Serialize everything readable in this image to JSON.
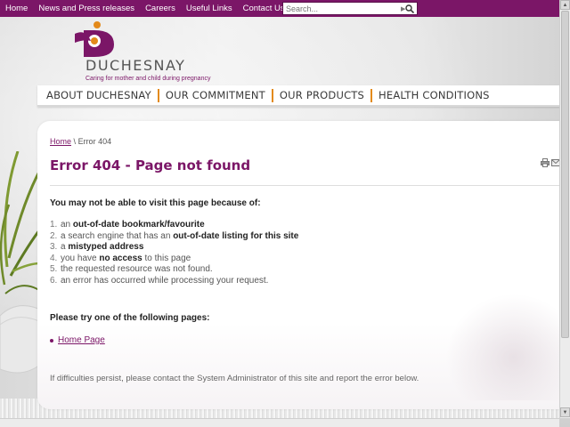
{
  "topnav": {
    "items": [
      "Home",
      "News and Press releases",
      "Careers",
      "Useful Links",
      "Contact Us"
    ]
  },
  "search": {
    "placeholder": "Search..."
  },
  "logo": {
    "name": "DUCHESNAY",
    "tagline": "Caring for mother and child during pregnancy"
  },
  "mainmenu": {
    "items": [
      "ABOUT DUCHESNAY",
      "OUR COMMITMENT",
      "OUR PRODUCTS",
      "HEALTH CONDITIONS"
    ]
  },
  "breadcrumb": {
    "home": "Home",
    "separator": "\\",
    "current": "Error 404"
  },
  "page": {
    "title": "Error 404 - Page not found",
    "intro": "You may not be able to visit this page because of:",
    "reasons": [
      {
        "num": "1.",
        "pre": "an ",
        "bold": "out-of-date bookmark/favourite",
        "post": ""
      },
      {
        "num": "2.",
        "pre": "a search engine that has an ",
        "bold": "out-of-date listing for this site",
        "post": ""
      },
      {
        "num": "3.",
        "pre": "a ",
        "bold": "mistyped address",
        "post": ""
      },
      {
        "num": "4.",
        "pre": "you have ",
        "bold": "no access",
        "post": " to this page"
      },
      {
        "num": "5.",
        "pre": "the requested resource was not found.",
        "bold": "",
        "post": ""
      },
      {
        "num": "6.",
        "pre": "an error has occurred while processing your request.",
        "bold": "",
        "post": ""
      }
    ],
    "try_heading": "Please try one of the following pages:",
    "links": [
      "Home Page"
    ],
    "footer_note": "If difficulties persist, please contact the System Administrator of this site and report the error below."
  },
  "tools": {
    "icons": [
      "print-icon",
      "email-icon"
    ]
  },
  "colors": {
    "brand": "#7b1667",
    "accent": "#e38a1a",
    "logo_orange": "#e38a1a"
  }
}
